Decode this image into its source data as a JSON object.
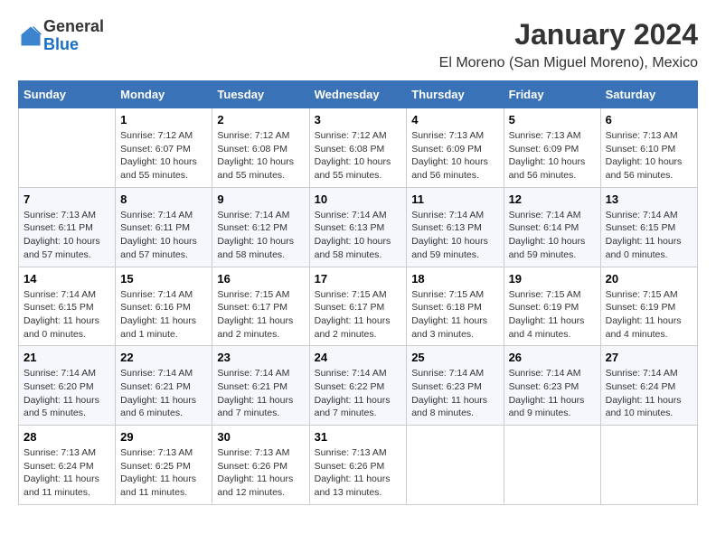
{
  "header": {
    "logo_general": "General",
    "logo_blue": "Blue",
    "title": "January 2024",
    "subtitle": "El Moreno (San Miguel Moreno), Mexico"
  },
  "days_of_week": [
    "Sunday",
    "Monday",
    "Tuesday",
    "Wednesday",
    "Thursday",
    "Friday",
    "Saturday"
  ],
  "weeks": [
    [
      {
        "day": "",
        "sunrise": "",
        "sunset": "",
        "daylight": ""
      },
      {
        "day": "1",
        "sunrise": "Sunrise: 7:12 AM",
        "sunset": "Sunset: 6:07 PM",
        "daylight": "Daylight: 10 hours and 55 minutes."
      },
      {
        "day": "2",
        "sunrise": "Sunrise: 7:12 AM",
        "sunset": "Sunset: 6:08 PM",
        "daylight": "Daylight: 10 hours and 55 minutes."
      },
      {
        "day": "3",
        "sunrise": "Sunrise: 7:12 AM",
        "sunset": "Sunset: 6:08 PM",
        "daylight": "Daylight: 10 hours and 55 minutes."
      },
      {
        "day": "4",
        "sunrise": "Sunrise: 7:13 AM",
        "sunset": "Sunset: 6:09 PM",
        "daylight": "Daylight: 10 hours and 56 minutes."
      },
      {
        "day": "5",
        "sunrise": "Sunrise: 7:13 AM",
        "sunset": "Sunset: 6:09 PM",
        "daylight": "Daylight: 10 hours and 56 minutes."
      },
      {
        "day": "6",
        "sunrise": "Sunrise: 7:13 AM",
        "sunset": "Sunset: 6:10 PM",
        "daylight": "Daylight: 10 hours and 56 minutes."
      }
    ],
    [
      {
        "day": "7",
        "sunrise": "Sunrise: 7:13 AM",
        "sunset": "Sunset: 6:11 PM",
        "daylight": "Daylight: 10 hours and 57 minutes."
      },
      {
        "day": "8",
        "sunrise": "Sunrise: 7:14 AM",
        "sunset": "Sunset: 6:11 PM",
        "daylight": "Daylight: 10 hours and 57 minutes."
      },
      {
        "day": "9",
        "sunrise": "Sunrise: 7:14 AM",
        "sunset": "Sunset: 6:12 PM",
        "daylight": "Daylight: 10 hours and 58 minutes."
      },
      {
        "day": "10",
        "sunrise": "Sunrise: 7:14 AM",
        "sunset": "Sunset: 6:13 PM",
        "daylight": "Daylight: 10 hours and 58 minutes."
      },
      {
        "day": "11",
        "sunrise": "Sunrise: 7:14 AM",
        "sunset": "Sunset: 6:13 PM",
        "daylight": "Daylight: 10 hours and 59 minutes."
      },
      {
        "day": "12",
        "sunrise": "Sunrise: 7:14 AM",
        "sunset": "Sunset: 6:14 PM",
        "daylight": "Daylight: 10 hours and 59 minutes."
      },
      {
        "day": "13",
        "sunrise": "Sunrise: 7:14 AM",
        "sunset": "Sunset: 6:15 PM",
        "daylight": "Daylight: 11 hours and 0 minutes."
      }
    ],
    [
      {
        "day": "14",
        "sunrise": "Sunrise: 7:14 AM",
        "sunset": "Sunset: 6:15 PM",
        "daylight": "Daylight: 11 hours and 0 minutes."
      },
      {
        "day": "15",
        "sunrise": "Sunrise: 7:14 AM",
        "sunset": "Sunset: 6:16 PM",
        "daylight": "Daylight: 11 hours and 1 minute."
      },
      {
        "day": "16",
        "sunrise": "Sunrise: 7:15 AM",
        "sunset": "Sunset: 6:17 PM",
        "daylight": "Daylight: 11 hours and 2 minutes."
      },
      {
        "day": "17",
        "sunrise": "Sunrise: 7:15 AM",
        "sunset": "Sunset: 6:17 PM",
        "daylight": "Daylight: 11 hours and 2 minutes."
      },
      {
        "day": "18",
        "sunrise": "Sunrise: 7:15 AM",
        "sunset": "Sunset: 6:18 PM",
        "daylight": "Daylight: 11 hours and 3 minutes."
      },
      {
        "day": "19",
        "sunrise": "Sunrise: 7:15 AM",
        "sunset": "Sunset: 6:19 PM",
        "daylight": "Daylight: 11 hours and 4 minutes."
      },
      {
        "day": "20",
        "sunrise": "Sunrise: 7:15 AM",
        "sunset": "Sunset: 6:19 PM",
        "daylight": "Daylight: 11 hours and 4 minutes."
      }
    ],
    [
      {
        "day": "21",
        "sunrise": "Sunrise: 7:14 AM",
        "sunset": "Sunset: 6:20 PM",
        "daylight": "Daylight: 11 hours and 5 minutes."
      },
      {
        "day": "22",
        "sunrise": "Sunrise: 7:14 AM",
        "sunset": "Sunset: 6:21 PM",
        "daylight": "Daylight: 11 hours and 6 minutes."
      },
      {
        "day": "23",
        "sunrise": "Sunrise: 7:14 AM",
        "sunset": "Sunset: 6:21 PM",
        "daylight": "Daylight: 11 hours and 7 minutes."
      },
      {
        "day": "24",
        "sunrise": "Sunrise: 7:14 AM",
        "sunset": "Sunset: 6:22 PM",
        "daylight": "Daylight: 11 hours and 7 minutes."
      },
      {
        "day": "25",
        "sunrise": "Sunrise: 7:14 AM",
        "sunset": "Sunset: 6:23 PM",
        "daylight": "Daylight: 11 hours and 8 minutes."
      },
      {
        "day": "26",
        "sunrise": "Sunrise: 7:14 AM",
        "sunset": "Sunset: 6:23 PM",
        "daylight": "Daylight: 11 hours and 9 minutes."
      },
      {
        "day": "27",
        "sunrise": "Sunrise: 7:14 AM",
        "sunset": "Sunset: 6:24 PM",
        "daylight": "Daylight: 11 hours and 10 minutes."
      }
    ],
    [
      {
        "day": "28",
        "sunrise": "Sunrise: 7:13 AM",
        "sunset": "Sunset: 6:24 PM",
        "daylight": "Daylight: 11 hours and 11 minutes."
      },
      {
        "day": "29",
        "sunrise": "Sunrise: 7:13 AM",
        "sunset": "Sunset: 6:25 PM",
        "daylight": "Daylight: 11 hours and 11 minutes."
      },
      {
        "day": "30",
        "sunrise": "Sunrise: 7:13 AM",
        "sunset": "Sunset: 6:26 PM",
        "daylight": "Daylight: 11 hours and 12 minutes."
      },
      {
        "day": "31",
        "sunrise": "Sunrise: 7:13 AM",
        "sunset": "Sunset: 6:26 PM",
        "daylight": "Daylight: 11 hours and 13 minutes."
      },
      {
        "day": "",
        "sunrise": "",
        "sunset": "",
        "daylight": ""
      },
      {
        "day": "",
        "sunrise": "",
        "sunset": "",
        "daylight": ""
      },
      {
        "day": "",
        "sunrise": "",
        "sunset": "",
        "daylight": ""
      }
    ]
  ]
}
